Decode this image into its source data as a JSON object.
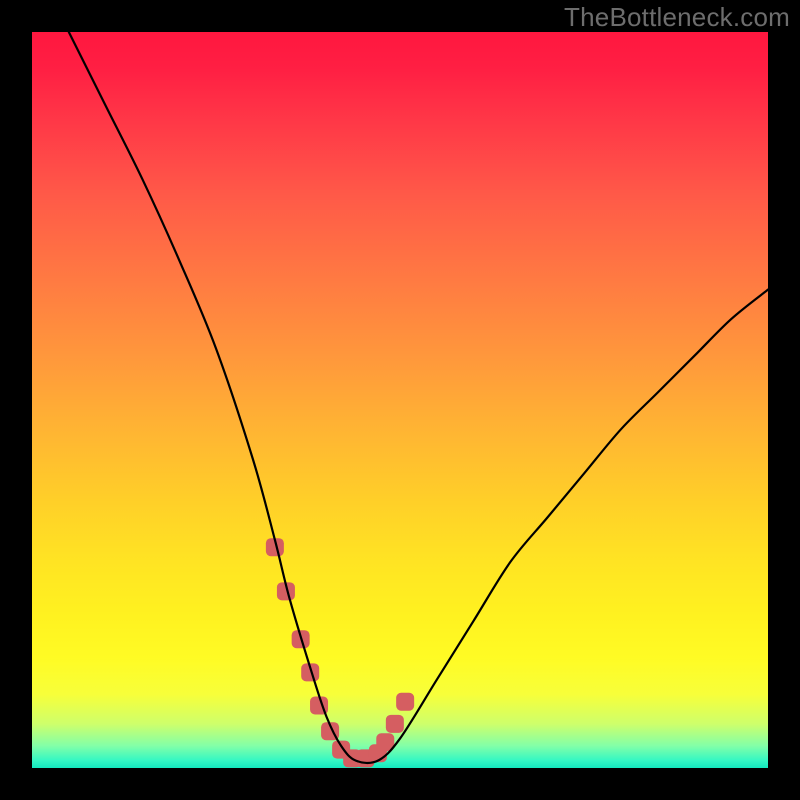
{
  "watermark": "TheBottleneck.com",
  "chart_data": {
    "type": "line",
    "title": "",
    "xlabel": "",
    "ylabel": "",
    "xlim": [
      0,
      100
    ],
    "ylim": [
      0,
      100
    ],
    "grid": false,
    "note": "Values are estimated from the rendered curve (no tick labels present). 0 is bottom/left, 100 is top/right.",
    "series": [
      {
        "name": "curve",
        "x": [
          5,
          10,
          15,
          20,
          25,
          30,
          33,
          35,
          38,
          40,
          42,
          44,
          47,
          50,
          55,
          60,
          65,
          70,
          75,
          80,
          85,
          90,
          95,
          100
        ],
        "y": [
          100,
          90,
          80,
          69,
          57,
          42,
          31,
          23,
          13,
          7,
          3,
          1,
          1,
          4,
          12,
          20,
          28,
          34,
          40,
          46,
          51,
          56,
          61,
          65
        ]
      }
    ],
    "highlight_points": {
      "name": "markers",
      "x": [
        33.0,
        34.5,
        36.5,
        37.8,
        39.0,
        40.5,
        42.0,
        43.5,
        45.3,
        47.0,
        48.0,
        49.3,
        50.7
      ],
      "y": [
        30.0,
        24.0,
        17.5,
        13.0,
        8.5,
        5.0,
        2.5,
        1.3,
        1.3,
        2.0,
        3.5,
        6.0,
        9.0
      ]
    },
    "colors": {
      "curve": "#000000",
      "markers": "#d55e61",
      "gradient_top": "#ff173f",
      "gradient_bottom": "#14e8bf"
    }
  }
}
